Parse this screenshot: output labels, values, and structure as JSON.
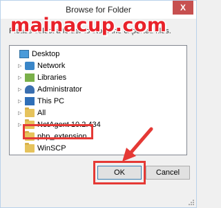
{
  "dialog": {
    "title": "Browse for Folder",
    "close_label": "X",
    "instruction": "Please select a folder to store the exported files."
  },
  "watermark": "mainacup.com",
  "tree": [
    {
      "label": "Desktop",
      "icon": "desktop-icon",
      "expander": ""
    },
    {
      "label": "Network",
      "icon": "network-icon",
      "expander": "▷"
    },
    {
      "label": "Libraries",
      "icon": "libraries-icon",
      "expander": "▷"
    },
    {
      "label": "Administrator",
      "icon": "user-icon",
      "expander": "▷"
    },
    {
      "label": "This PC",
      "icon": "computer-icon",
      "expander": "▷"
    },
    {
      "label": "All",
      "icon": "folder-icon",
      "expander": "▷"
    },
    {
      "label": "NetAgent 10.2.434",
      "icon": "folder-icon",
      "expander": "▷"
    },
    {
      "label": "php_extension",
      "icon": "folder-icon",
      "expander": ""
    },
    {
      "label": "WinSCP",
      "icon": "folder-icon",
      "expander": ""
    }
  ],
  "buttons": {
    "ok": "OK",
    "cancel": "Cancel"
  },
  "colors": {
    "highlight": "#e53935",
    "folder": "#e6c35c"
  }
}
